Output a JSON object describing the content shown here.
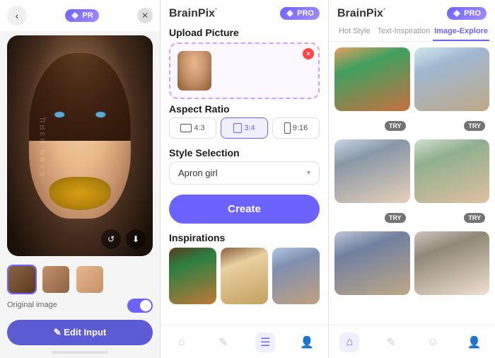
{
  "panel1": {
    "back_icon": "‹",
    "pro_label": "PR",
    "close_icon": "✕",
    "watermark": "KYBN НЗЯЦ",
    "original_label": "Original image",
    "edit_input_label": "✎ Edit Input",
    "thumbnails": [
      {
        "id": 1,
        "active": true
      },
      {
        "id": 2,
        "active": false
      },
      {
        "id": 3,
        "active": false
      }
    ]
  },
  "panel2": {
    "logo": "BrainPix",
    "logo_sup": "*",
    "pro_label": "PRO",
    "upload_section": "Upload Picture",
    "upload_close": "✕",
    "aspect_ratio_section": "Aspect Ratio",
    "aspect_options": [
      {
        "label": "4:3",
        "active": false,
        "wide": true
      },
      {
        "label": "3:4",
        "active": true,
        "wide": false
      },
      {
        "label": "9:16",
        "active": false,
        "wide": false
      }
    ],
    "style_section": "Style Selection",
    "style_value": "Apron girl",
    "style_chevron": "▾",
    "create_label": "Create",
    "inspirations_section": "Inspirations",
    "nav_icons": [
      "⌂",
      "✎",
      "☰",
      "👤"
    ]
  },
  "panel3": {
    "logo": "BrainPix",
    "logo_sup": "*",
    "pro_label": "PRO",
    "tabs": [
      {
        "label": "Hot Style",
        "active": false
      },
      {
        "label": "Text-Inspiration",
        "active": false
      },
      {
        "label": "Image-Explore",
        "active": true
      }
    ],
    "try_label": "TRY",
    "nav_icons": [
      "⌂",
      "✎",
      "☺",
      "👤"
    ]
  }
}
